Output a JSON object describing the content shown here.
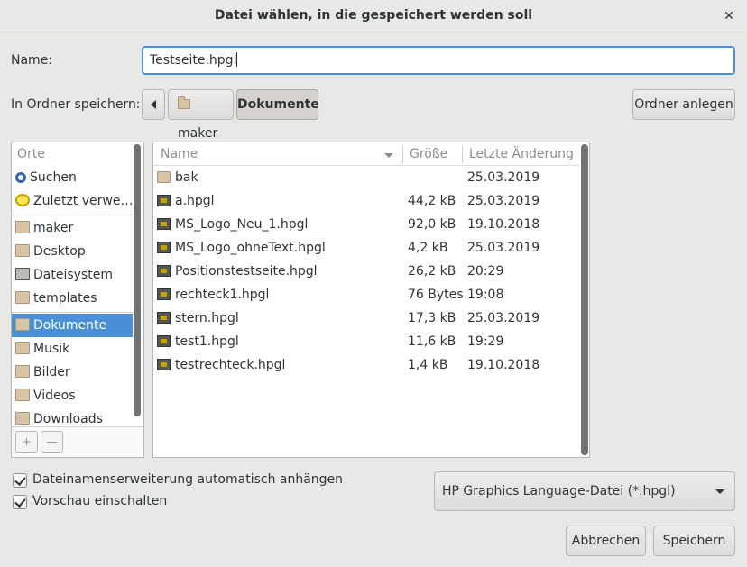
{
  "window": {
    "title": "Datei wählen, in die gespeichert werden soll",
    "close_icon": "close-icon"
  },
  "name_field": {
    "label": "Name:",
    "value": "Testseite.hpgl"
  },
  "folder": {
    "label": "In Ordner speichern:",
    "path": [
      "maker",
      "Dokumente"
    ],
    "create_folder_label": "Ordner anlegen"
  },
  "sidebar": {
    "header": "Orte",
    "items": [
      {
        "label": "Suchen",
        "icon": "search-icon"
      },
      {
        "label": "Zuletzt verwe…",
        "icon": "recent-icon"
      },
      {
        "label": "maker",
        "icon": "home-folder-icon"
      },
      {
        "label": "Desktop",
        "icon": "folder-icon"
      },
      {
        "label": "Dateisystem",
        "icon": "drive-icon"
      },
      {
        "label": "templates",
        "icon": "folder-icon"
      },
      {
        "label": "Dokumente",
        "icon": "folder-icon",
        "selected": true
      },
      {
        "label": "Musik",
        "icon": "folder-icon"
      },
      {
        "label": "Bilder",
        "icon": "folder-icon"
      },
      {
        "label": "Videos",
        "icon": "folder-icon"
      },
      {
        "label": "Downloads",
        "icon": "folder-icon"
      }
    ],
    "add_label": "+",
    "remove_label": "—"
  },
  "files": {
    "columns": [
      "Name",
      "Größe",
      "Letzte Änderung"
    ],
    "rows": [
      {
        "name": "bak",
        "size": "",
        "date": "25.03.2019",
        "type": "folder"
      },
      {
        "name": "a.hpgl",
        "size": "44,2 kB",
        "date": "25.03.2019",
        "type": "file"
      },
      {
        "name": "MS_Logo_Neu_1.hpgl",
        "size": "92,0 kB",
        "date": "19.10.2018",
        "type": "file"
      },
      {
        "name": "MS_Logo_ohneText.hpgl",
        "size": "4,2 kB",
        "date": "25.03.2019",
        "type": "file"
      },
      {
        "name": "Positionstestseite.hpgl",
        "size": "26,2 kB",
        "date": "20:29",
        "type": "file"
      },
      {
        "name": "rechteck1.hpgl",
        "size": "76 Bytes",
        "date": "19:08",
        "type": "file"
      },
      {
        "name": "stern.hpgl",
        "size": "17,3 kB",
        "date": "25.03.2019",
        "type": "file"
      },
      {
        "name": "test1.hpgl",
        "size": "11,6 kB",
        "date": "19:29",
        "type": "file"
      },
      {
        "name": "testrechteck.hpgl",
        "size": "1,4 kB",
        "date": "19.10.2018",
        "type": "file"
      }
    ]
  },
  "options": {
    "auto_extension": {
      "label": "Dateinamenserweiterung automatisch anhängen",
      "checked": true
    },
    "preview": {
      "label": "Vorschau einschalten",
      "checked": true
    }
  },
  "filter": {
    "selected": "HP Graphics Language-Datei (*.hpgl)"
  },
  "actions": {
    "cancel": "Abbrechen",
    "save": "Speichern"
  }
}
